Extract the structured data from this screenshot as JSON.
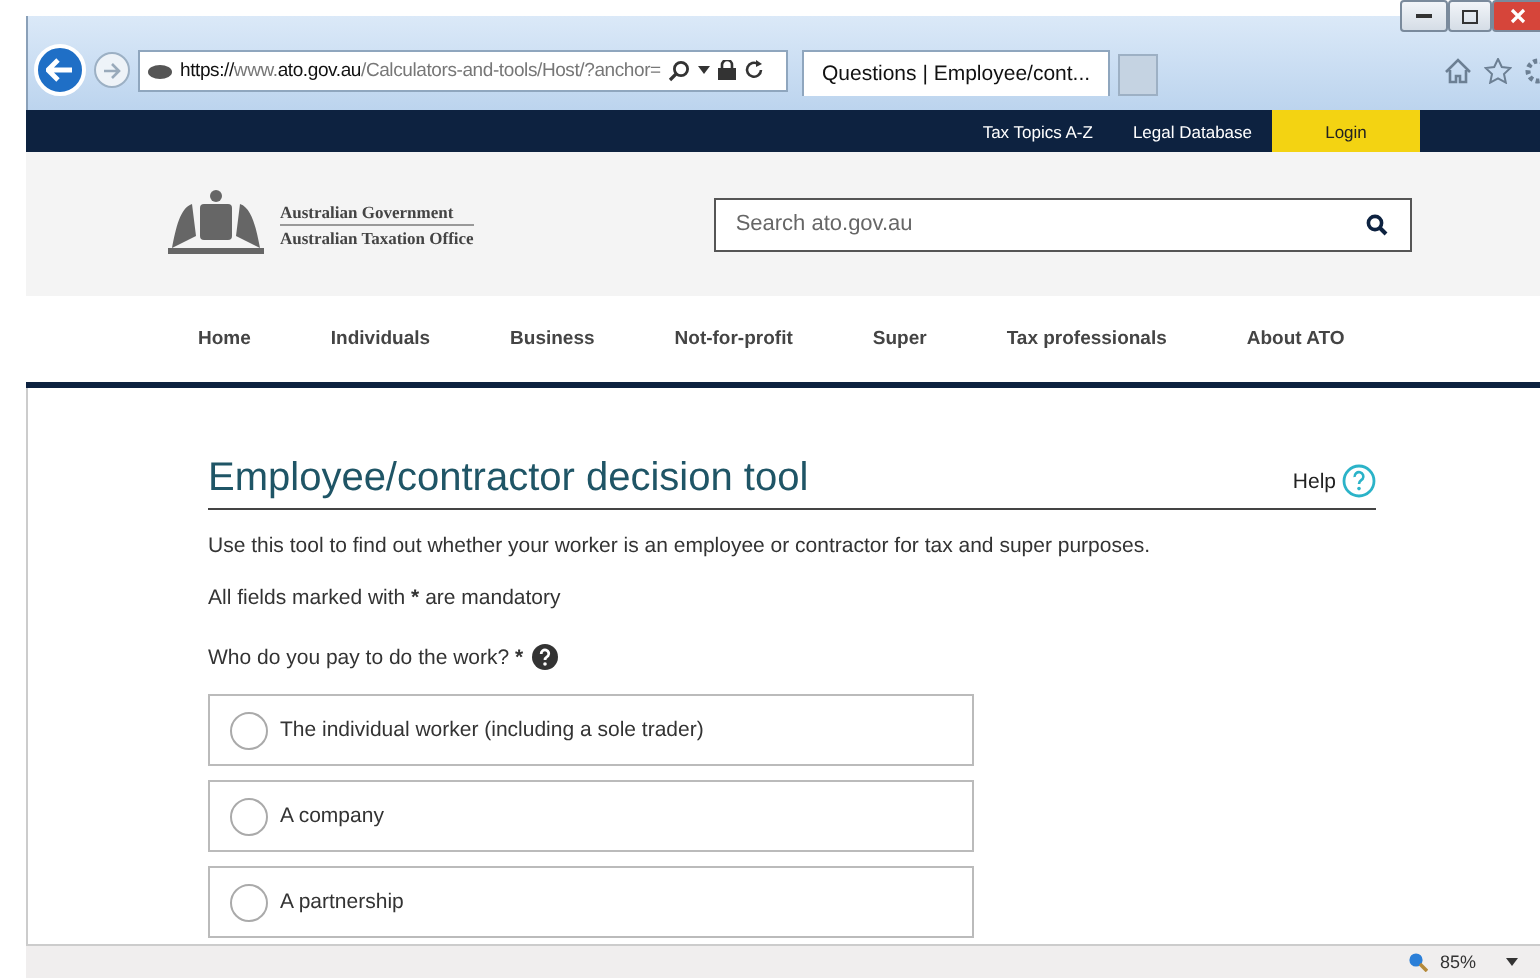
{
  "browser": {
    "url_parts": [
      {
        "text": "https://",
        "strong": true
      },
      {
        "text": "www.",
        "strong": false
      },
      {
        "text": "ato.gov.au",
        "strong": true
      },
      {
        "text": "/Calculators-and-tools/Host/?anchor=",
        "strong": false
      }
    ],
    "tabs": [
      {
        "title": "Questions | Employee/cont...",
        "selected": true
      }
    ],
    "zoom": "85%"
  },
  "top_bar": {
    "links": [
      "Tax Topics A-Z",
      "Legal Database"
    ],
    "login": "Login"
  },
  "header": {
    "logo_lines": [
      "Australian Government",
      "Australian Taxation Office"
    ],
    "search": {
      "placeholder": "Search ato.gov.au"
    }
  },
  "nav": {
    "items": [
      "Home",
      "Individuals",
      "Business",
      "Not-for-profit",
      "Super",
      "Tax professionals",
      "About ATO"
    ]
  },
  "tool": {
    "title": "Employee/contractor decision tool",
    "help": "Help",
    "intro": "Use this tool to find out whether your worker is an employee or contractor for tax and super purposes.",
    "mandatory": {
      "before": "All fields marked with",
      "mark": "*",
      "after": "are mandatory"
    },
    "question": {
      "text": "Who do you pay to do the work?",
      "mark": "*"
    },
    "options": [
      {
        "label": "The individual worker (including a sole trader)",
        "selected": false
      },
      {
        "label": "A company",
        "selected": false
      },
      {
        "label": "A partnership",
        "selected": false
      }
    ]
  }
}
